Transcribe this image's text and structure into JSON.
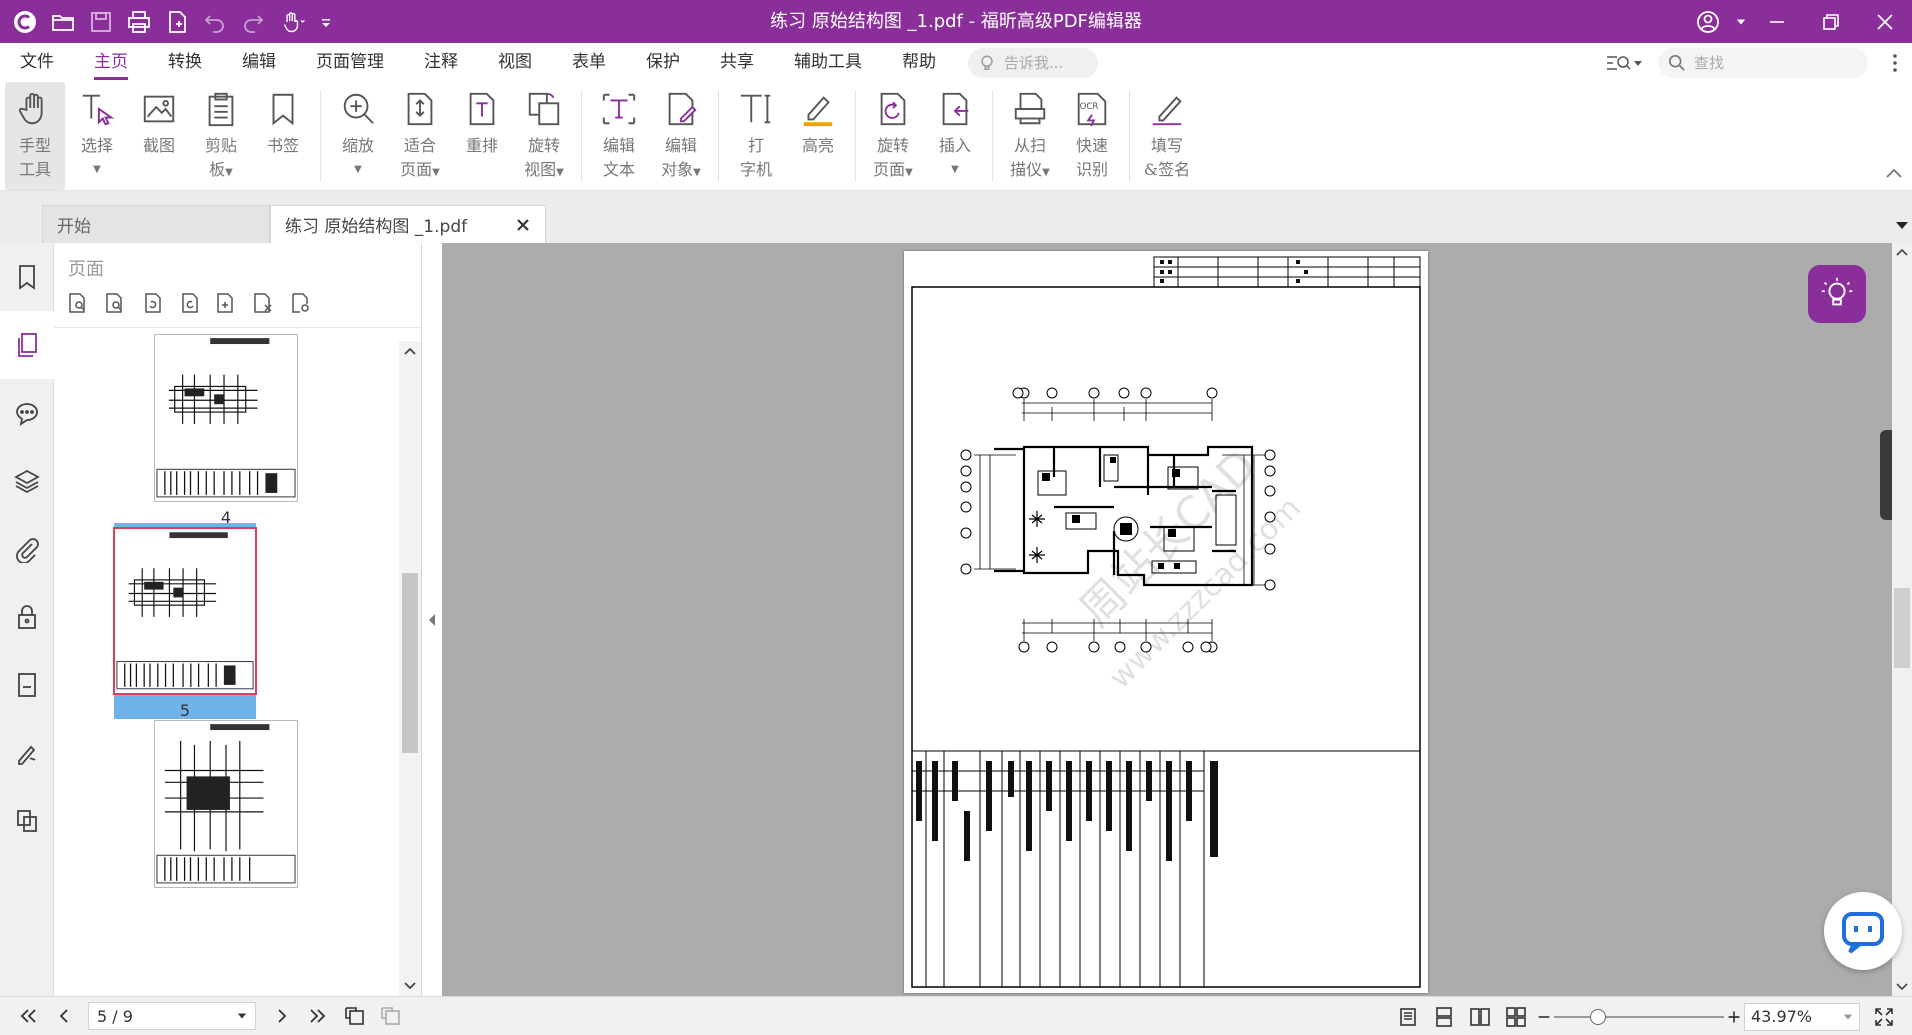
{
  "titlebar": {
    "title": "练习 原始结构图 _1.pdf - 福昕高级PDF编辑器"
  },
  "menu": {
    "items": [
      "文件",
      "主页",
      "转换",
      "编辑",
      "页面管理",
      "注释",
      "视图",
      "表单",
      "保护",
      "共享",
      "辅助工具",
      "帮助"
    ],
    "active_index": 1,
    "tell_me_placeholder": "告诉我...",
    "search_placeholder": "查找"
  },
  "ribbon": {
    "hand": [
      "手型",
      "工具"
    ],
    "select": "选择",
    "snapshot": "截图",
    "clipboard": [
      "剪贴",
      "板"
    ],
    "bookmark": "书签",
    "zoom": "缩放",
    "fit_page": [
      "适合",
      "页面"
    ],
    "reflow": "重排",
    "rotate_view": [
      "旋转",
      "视图"
    ],
    "edit_text": [
      "编辑",
      "文本"
    ],
    "edit_object": [
      "编辑",
      "对象"
    ],
    "typewriter": [
      "打",
      "字机"
    ],
    "highlight": "高亮",
    "rotate_page": [
      "旋转",
      "页面"
    ],
    "insert": "插入",
    "from_scanner": [
      "从扫",
      "描仪"
    ],
    "quick_ocr": [
      "快速",
      "识别"
    ],
    "fill_sign": [
      "填写",
      "&签名"
    ]
  },
  "tabs": {
    "start": "开始",
    "current": "练习 原始结构图 _1.pdf"
  },
  "pages_panel": {
    "title": "页面",
    "thumbs": [
      {
        "label": "4",
        "selected": false
      },
      {
        "label": "5",
        "selected": true
      },
      {
        "label": "",
        "selected": false
      }
    ]
  },
  "document": {
    "watermark_line1": "周站长CAD",
    "watermark_line2": "www.zzzcad.com"
  },
  "statusbar": {
    "page_indicator": "5 / 9",
    "zoom": "43.97%"
  },
  "colors": {
    "brand": "#8a2f9a",
    "thumb_selected": "#6fb3ea",
    "viewer_bg": "#acacac"
  }
}
